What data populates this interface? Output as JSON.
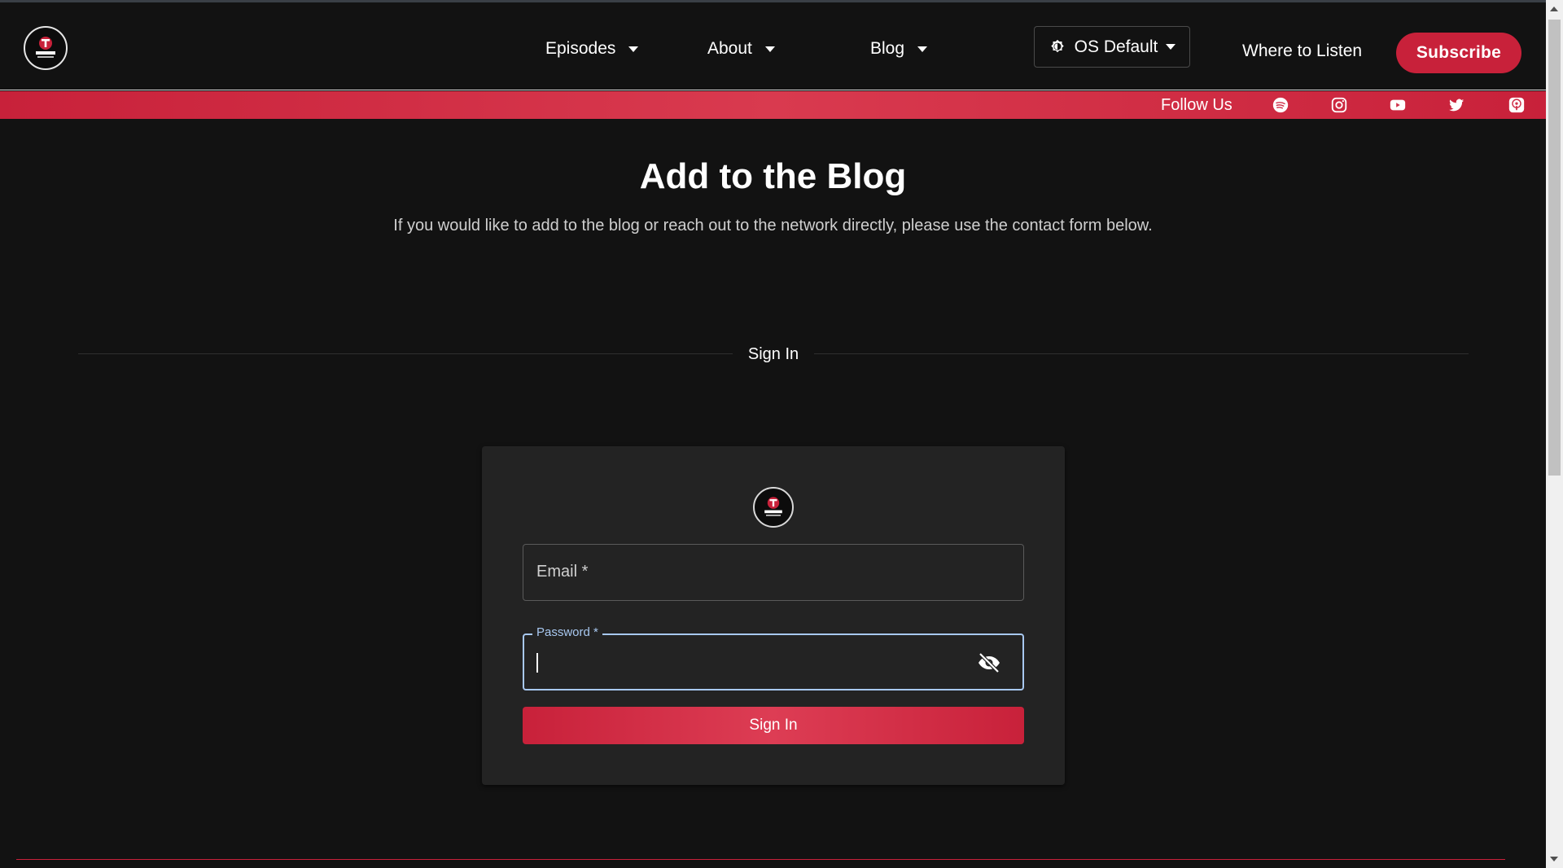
{
  "header": {
    "logo_icon": "takeover-logo-icon",
    "nav": [
      {
        "label": "Episodes"
      },
      {
        "label": "About"
      },
      {
        "label": "Blog"
      }
    ],
    "theme_label": "OS Default",
    "where_to_listen": "Where to Listen",
    "subscribe": "Subscribe"
  },
  "follow_bar": {
    "label": "Follow Us",
    "icons": [
      "spotify-icon",
      "instagram-icon",
      "youtube-icon",
      "twitter-icon",
      "apple-podcasts-icon"
    ]
  },
  "main": {
    "title": "Add to the Blog",
    "subtitle": "If you would like to add to the blog or reach out to the network directly, please use the contact form below.",
    "divider_label": "Sign In"
  },
  "signin_form": {
    "email_label": "Email *",
    "password_label": "Password *",
    "submit_label": "Sign In"
  },
  "colors": {
    "accent": "#c8213a",
    "background": "#121212",
    "card": "#232323",
    "focus": "#a8c8f0"
  }
}
